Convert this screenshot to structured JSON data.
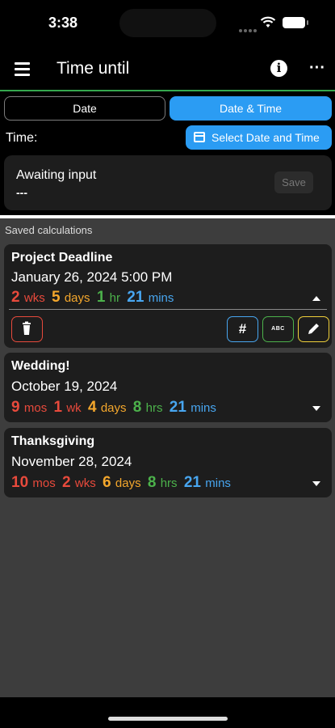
{
  "status_bar": {
    "time": "3:38"
  },
  "app_bar": {
    "title": "Time until",
    "menu_icon": "hamburger-menu-icon",
    "info_icon": "info-icon",
    "more_icon": "more-horizontal-icon"
  },
  "mode_selector": {
    "options": [
      "Date",
      "Date & Time"
    ],
    "selected": "Date & Time"
  },
  "input": {
    "time_label": "Time:",
    "select_button_label": "Select Date and Time",
    "status": "Awaiting input",
    "result": "---",
    "save_label": "Save"
  },
  "saved": {
    "header": "Saved calculations",
    "items": [
      {
        "name": "Project Deadline",
        "date": "January 26, 2024 5:00 PM",
        "parts": [
          {
            "value": "2",
            "unit": "wks",
            "color": "#e84a3c"
          },
          {
            "value": "5",
            "unit": "days",
            "color": "#f4a72c"
          },
          {
            "value": "1",
            "unit": "hr",
            "color": "#4cb24b"
          },
          {
            "value": "21",
            "unit": "mins",
            "color": "#48a6f0"
          }
        ],
        "expanded": true,
        "actions": {
          "delete": "trash-icon",
          "number_format": "#",
          "text_format": "ABC",
          "edit": "pencil-icon"
        }
      },
      {
        "name": "Wedding!",
        "date": "October 19, 2024",
        "parts": [
          {
            "value": "9",
            "unit": "mos",
            "color": "#e84a3c"
          },
          {
            "value": "1",
            "unit": "wk",
            "color": "#e84a3c"
          },
          {
            "value": "4",
            "unit": "days",
            "color": "#f4a72c"
          },
          {
            "value": "8",
            "unit": "hrs",
            "color": "#4cb24b"
          },
          {
            "value": "21",
            "unit": "mins",
            "color": "#48a6f0"
          }
        ],
        "expanded": false
      },
      {
        "name": "Thanksgiving",
        "date": "November 28, 2024",
        "parts": [
          {
            "value": "10",
            "unit": "mos",
            "color": "#e84a3c"
          },
          {
            "value": "2",
            "unit": "wks",
            "color": "#e84a3c"
          },
          {
            "value": "6",
            "unit": "days",
            "color": "#f4a72c"
          },
          {
            "value": "8",
            "unit": "hrs",
            "color": "#4cb24b"
          },
          {
            "value": "21",
            "unit": "mins",
            "color": "#48a6f0"
          }
        ],
        "expanded": false
      }
    ]
  },
  "colors": {
    "accent": "#2b9cf3",
    "divider_green": "#35a84e"
  }
}
